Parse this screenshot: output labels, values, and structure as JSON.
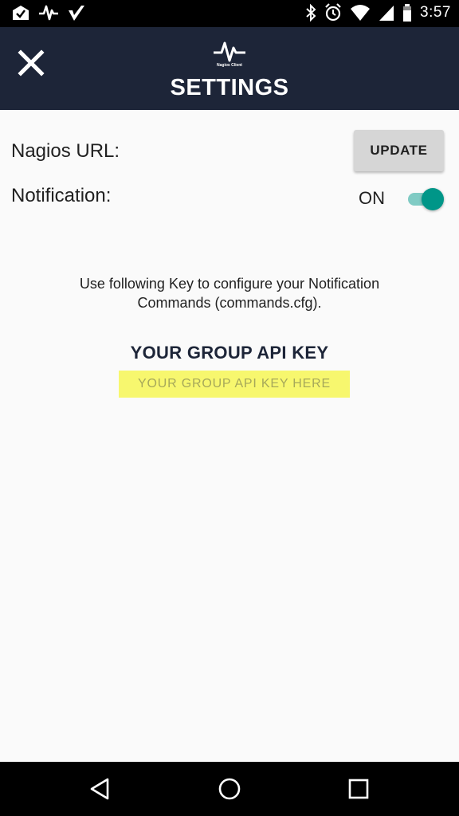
{
  "status_bar": {
    "time": "3:57",
    "left_icons": [
      "inbox-check-icon",
      "pulse-icon",
      "check-mark-icon"
    ],
    "right_icons": [
      "bluetooth-icon",
      "alarm-icon",
      "wifi-icon",
      "cell-signal-icon",
      "battery-icon"
    ]
  },
  "app_bar": {
    "title": "SETTINGS",
    "logo_text": "Nagios Client",
    "close_icon": "close-icon",
    "background": "#1d2538"
  },
  "settings": {
    "nagios_url_label": "Nagios URL:",
    "update_button_label": "UPDATE",
    "notification_label": "Notification:",
    "notification_state": "ON",
    "notification_enabled": true,
    "toggle_color": "#009688"
  },
  "info": {
    "instructions_line1": "Use following Key to configure your Notification",
    "instructions_line2": "Commands (commands.cfg).",
    "key_heading": "YOUR GROUP API KEY",
    "key_value": "YOUR GROUP API KEY HERE",
    "key_highlight_color": "#f7f76e"
  },
  "nav_bar": {
    "back": "back-triangle-icon",
    "home": "home-circle-icon",
    "recents": "recents-square-icon"
  }
}
